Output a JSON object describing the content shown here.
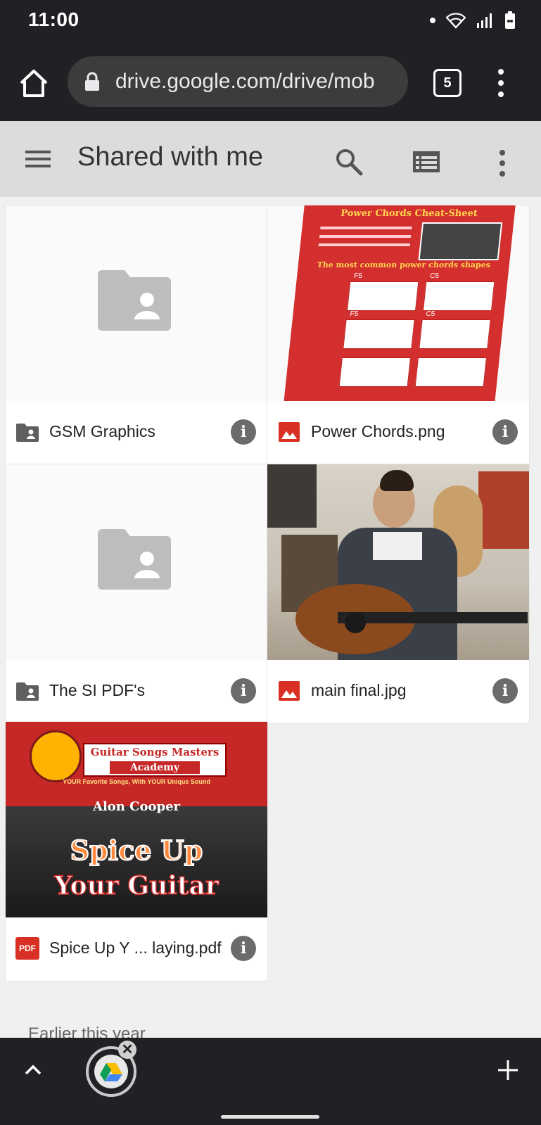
{
  "status_bar": {
    "time": "11:00"
  },
  "browser": {
    "url": "drive.google.com/drive/mob",
    "tab_count": "5"
  },
  "drive": {
    "title": "Shared with me"
  },
  "items": [
    {
      "name": "GSM Graphics",
      "type": "folder-shared"
    },
    {
      "name": "Power Chords.png",
      "type": "image"
    },
    {
      "name": "The SI PDF's",
      "type": "folder-shared"
    },
    {
      "name": "main final.jpg",
      "type": "image"
    },
    {
      "name": "Spice Up Y ... laying.pdf",
      "type": "pdf"
    }
  ],
  "thumbnails": {
    "power_chords": {
      "title": "Power Chords Cheat-Sheet",
      "subtitle": "The most common power chords shapes",
      "chords": [
        "F5",
        "C5",
        "F5",
        "C5"
      ]
    },
    "pdf": {
      "brand_line1": "Guitar Songs Masters",
      "brand_line2": "Academy",
      "tagline": "YOUR Favorite Songs, With YOUR Unique Sound",
      "author": "Alon Cooper",
      "headline1": "Spice Up",
      "headline2": "Your Guitar"
    }
  },
  "section_label": "Earlier this year",
  "pdf_badge": "PDF",
  "info_glyph": "i",
  "close_glyph": "✕",
  "colors": {
    "image_icon": "#d93025",
    "pdf_icon": "#d93025",
    "folder_gray": "#bdbdbd"
  }
}
